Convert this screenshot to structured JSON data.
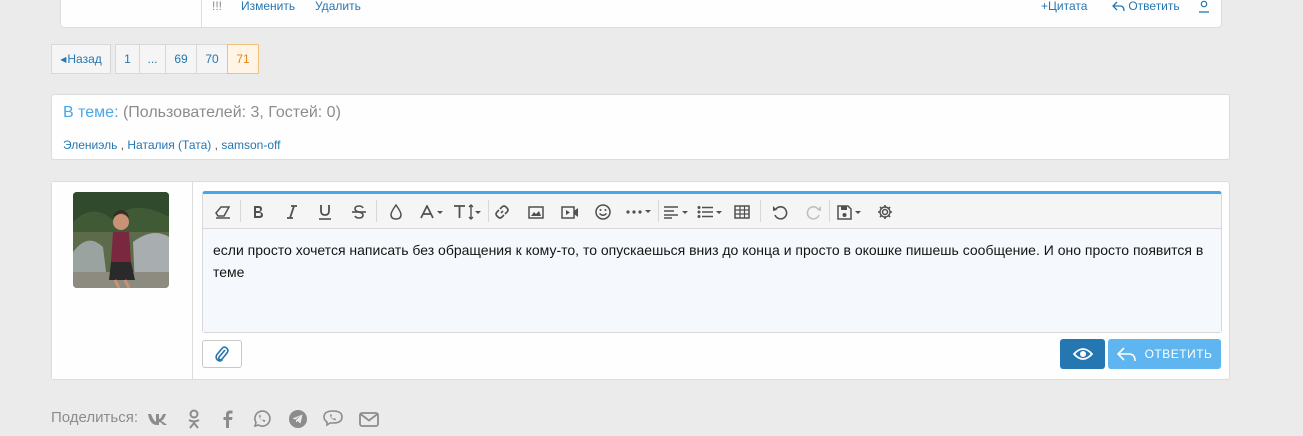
{
  "post_actions": {
    "exclaim": "!!!",
    "edit": "Изменить",
    "delete": "Удалить",
    "quote": "Цитата",
    "reply": "Ответить"
  },
  "pagination": {
    "prev": "Назад",
    "pages": [
      "1",
      "...",
      "69",
      "70",
      "71"
    ],
    "current": "71"
  },
  "online": {
    "label": "В теме:",
    "stats": "(Пользователей: 3, Гостей: 0)",
    "users": [
      "Элениэль",
      "Наталия (Тата)",
      "samson-off"
    ],
    "separator": ","
  },
  "editor": {
    "text": "если просто хочется написать без обращения к кому-то, то опускаешься вниз до конца и просто в окошке пишешь сообщение. И оно просто появится в теме",
    "toolbar": [
      "eraser-icon",
      "bold-icon",
      "italic-icon",
      "underline-icon",
      "strikethrough-icon",
      "color-icon",
      "font-family-icon",
      "font-size-icon",
      "link-icon",
      "image-icon",
      "video-icon",
      "smilie-icon",
      "more-icon",
      "align-icon",
      "list-icon",
      "table-icon",
      "undo-icon",
      "redo-icon",
      "drafts-icon",
      "settings-icon"
    ]
  },
  "buttons": {
    "submit": "ОТВЕТИТЬ"
  },
  "share": {
    "label": "Поделиться:",
    "networks": [
      "vk-icon",
      "odnoklassniki-icon",
      "facebook-icon",
      "whatsapp-icon",
      "telegram-icon",
      "viber-icon",
      "email-icon"
    ]
  },
  "colors": {
    "link": "#2577b1",
    "accent": "#47a7eb",
    "current_page_bg": "#fff4e5",
    "primary_button": "#2577b1",
    "submit_button": "#5eb5f0"
  }
}
